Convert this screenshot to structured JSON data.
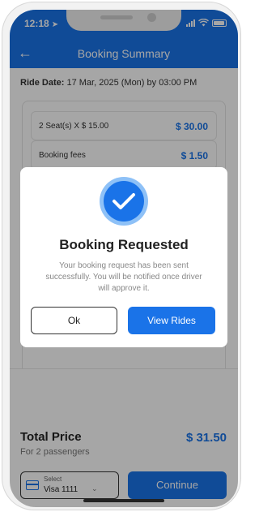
{
  "status_bar": {
    "time": "12:18",
    "location_glyph": "➤"
  },
  "header": {
    "title": "Booking Summary",
    "back_glyph": "←"
  },
  "ride": {
    "date_label": "Ride Date:",
    "date_value": "17 Mar, 2025 (Mon) by 03:00 PM"
  },
  "fares": [
    {
      "label": "2 Seat(s) X $ 15.00",
      "value": "$ 30.00"
    },
    {
      "label": "Booking fees",
      "value": "$ 1.50"
    }
  ],
  "total": {
    "label": "Total Price",
    "subtitle": "For 2 passengers",
    "value": "$ 31.50"
  },
  "payment": {
    "select_label": "Select",
    "method": "Visa 1111",
    "chevron_glyph": "⌄"
  },
  "continue_label": "Continue",
  "modal": {
    "title": "Booking Requested",
    "message": "Your booking request has been sent successfully. You will be notified once driver will approve it.",
    "ok_label": "Ok",
    "view_label": "View Rides"
  },
  "colors": {
    "primary": "#1a73e8",
    "overlay": "rgba(0,0,0,0.35)"
  }
}
